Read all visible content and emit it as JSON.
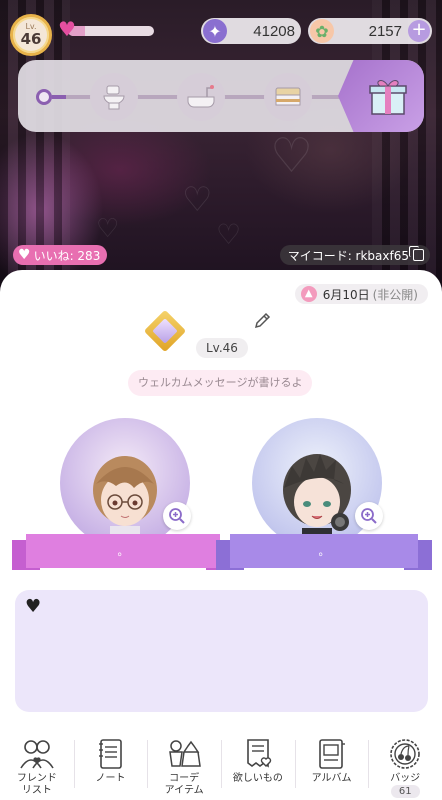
{
  "status_bar": {
    "level_small": "Lv.",
    "level": "46",
    "heart_gauge_fraction": 0.2,
    "gems": "41208",
    "flowers": "2157",
    "add_icon": "plus-icon"
  },
  "progress": {
    "steps": [
      "toilet-icon",
      "bathtub-icon",
      "bed-icon"
    ],
    "goal_icon": "gift-box-icon"
  },
  "likes": {
    "label": "いいね: 283"
  },
  "my_code": {
    "label": "マイコード: rkbaxf65"
  },
  "profile": {
    "date": "6月10日",
    "privacy": "(非公開)",
    "level_label": "Lv.46",
    "welcome_message": "ウェルカムメッセージが書けるよ"
  },
  "characters": [
    {
      "name": "。",
      "color": "#df7fe0"
    },
    {
      "name": "。",
      "color": "#a88ae8"
    }
  ],
  "comment": {
    "icon": "black-heart-icon"
  },
  "nav": {
    "items": [
      {
        "label": "フレンド\nリスト",
        "icon": "friends-icon"
      },
      {
        "label": "ノート",
        "icon": "notebook-icon"
      },
      {
        "label": "コーデ\nアイテム",
        "icon": "outfit-icon"
      },
      {
        "label": "欲しいもの",
        "icon": "wishlist-icon"
      },
      {
        "label": "アルバム",
        "icon": "album-icon"
      },
      {
        "label": "バッジ",
        "icon": "badge-icon",
        "count": "61"
      }
    ]
  }
}
